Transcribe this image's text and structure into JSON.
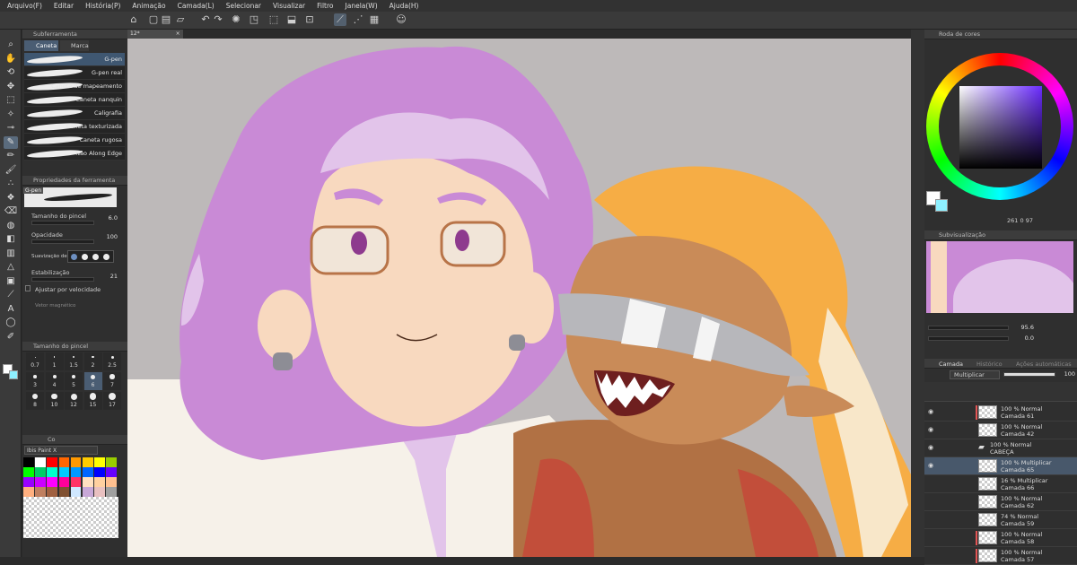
{
  "menu": [
    "Arquivo(F)",
    "Editar",
    "História(P)",
    "Animação",
    "Camada(L)",
    "Selecionar",
    "Visualizar",
    "Filtro",
    "Janela(W)",
    "Ajuda(H)"
  ],
  "canvas_tab": "12*",
  "sub_tool_panel": {
    "title": "Subferramenta",
    "tabs": [
      "Caneta",
      "Marca"
    ],
    "brushes": [
      "G-pen",
      "G-pen real",
      "Caneta de mapeamento",
      "Caneta nanquin",
      "Caligrafia",
      "Caneta texturizada",
      "Caneta rugosa",
      "Não Along Edge"
    ]
  },
  "tool_property": {
    "title": "Propriedades da ferramenta",
    "brush_name": "G-pen",
    "brush_size_label": "Tamanho do pincel",
    "brush_size_value": "6.0",
    "opacity_label": "Opacidade",
    "opacity_value": "100",
    "antialias_label": "Suavização de",
    "stabilization_label": "Estabilização",
    "stabilization_value": "21",
    "speed_label": "Ajustar por velocidade",
    "vector_label": "Vetor magnético"
  },
  "brush_size_panel": {
    "title": "Tamanho do pincel",
    "sizes": [
      "0.7",
      "1",
      "1.5",
      "2",
      "2.5",
      "3",
      "4",
      "5",
      "6",
      "7",
      "8",
      "10",
      "12",
      "15",
      "17"
    ],
    "selected": "6"
  },
  "color_set": {
    "title": "Co",
    "set_name": "Ibis Paint X",
    "colors": [
      "#000000",
      "#ffffff",
      "#ff0000",
      "#ff6600",
      "#ff9900",
      "#ffcc00",
      "#ffff00",
      "#99cc00",
      "#00ff00",
      "#00cc66",
      "#00ffcc",
      "#00ccff",
      "#0099ff",
      "#0066ff",
      "#0000ff",
      "#6600ff",
      "#9900ff",
      "#cc00ff",
      "#ff00ff",
      "#ff0099",
      "#ff3366",
      "#ffe0c0",
      "#ffd0a0",
      "#ffc090",
      "#ffb080",
      "#c08060",
      "#a06040",
      "#805030",
      "#d0e8ff",
      "#c8a8d8",
      "#e8c0c0",
      "#a0a0a0"
    ]
  },
  "color_wheel": {
    "title": "Roda de cores",
    "h": "261",
    "s": "0",
    "v": "97"
  },
  "sub_view": {
    "title": "Subvisualização",
    "zoom": "95.6",
    "angle": "0.0"
  },
  "layer_panel": {
    "tabs": [
      "Camada",
      "Histórico",
      "Ações automáticas"
    ],
    "blend_mode": "Multiplicar",
    "opacity": "100",
    "layers": [
      {
        "line1": "100 % Normal",
        "line2": "Camada 61",
        "red": true,
        "eye": true,
        "selected": false,
        "folder": false
      },
      {
        "line1": "100 % Normal",
        "line2": "Camada 42",
        "red": false,
        "eye": true,
        "selected": false,
        "folder": false
      },
      {
        "line1": "100 % Normal",
        "line2": "CABEÇA",
        "red": false,
        "eye": true,
        "selected": false,
        "folder": true
      },
      {
        "line1": "100 % Multiplicar",
        "line2": "Camada 65",
        "red": false,
        "eye": true,
        "selected": true,
        "folder": false
      },
      {
        "line1": "16 % Multiplicar",
        "line2": "Camada 66",
        "red": false,
        "eye": false,
        "selected": false,
        "folder": false
      },
      {
        "line1": "100 % Normal",
        "line2": "Camada 62",
        "red": false,
        "eye": false,
        "selected": false,
        "folder": false
      },
      {
        "line1": "74 % Normal",
        "line2": "Camada 59",
        "red": false,
        "eye": false,
        "selected": false,
        "folder": false
      },
      {
        "line1": "100 % Normal",
        "line2": "Camada 58",
        "red": true,
        "eye": false,
        "selected": false,
        "folder": false
      },
      {
        "line1": "100 % Normal",
        "line2": "Camada 57",
        "red": true,
        "eye": false,
        "selected": false,
        "folder": false
      }
    ]
  },
  "icons": {
    "tools": [
      "zoom-icon",
      "hand-icon",
      "rotate-icon",
      "move-icon",
      "select-icon",
      "wand-icon",
      "eyedropper-icon",
      "pen-icon",
      "pencil-icon",
      "brush-icon",
      "airbrush-icon",
      "decoration-icon",
      "eraser-icon",
      "blend-icon",
      "fill-icon",
      "gradient-icon",
      "figure-icon",
      "frame-icon",
      "ruler-icon",
      "text-icon",
      "balloon-icon",
      "line-correction-icon"
    ]
  },
  "colors": {
    "hair_purple": "#c98ad6",
    "hair_light": "#e2c4ea",
    "skin_light": "#f8d9bf",
    "skin_tan": "#c98b58",
    "hair_orange": "#f6ad45",
    "canvas_bg": "#bdb9b9"
  }
}
